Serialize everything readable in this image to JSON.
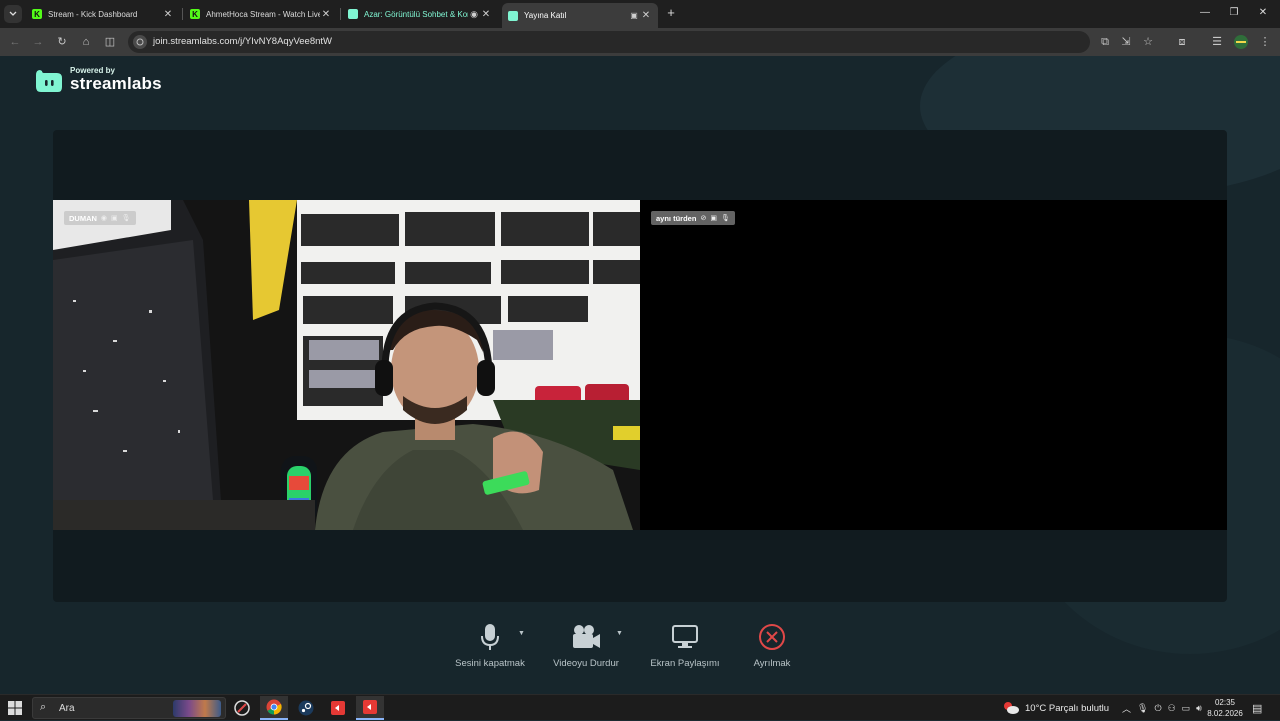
{
  "browser": {
    "tabs": [
      {
        "title": "Stream - Kick Dashboard",
        "favicon": "kick-icon",
        "active": false
      },
      {
        "title": "AhmetHoca Stream - Watch Live",
        "favicon": "kick-icon",
        "active": false
      },
      {
        "title": "Azar: Görüntülü Sohbet & Konuş",
        "favicon": "streamlabs-icon",
        "active": false
      },
      {
        "title": "Yayına Katıl",
        "favicon": "streamlabs-icon",
        "active": true
      }
    ],
    "url": "join.streamlabs.com/j/YIvNY8AqyVee8ntW"
  },
  "page": {
    "logo": {
      "powered_by": "Powered by",
      "name": "streamlabs"
    },
    "participants": [
      {
        "name": "DUMAN",
        "video": "camera-feed"
      },
      {
        "name": "aynı türden",
        "video": "none"
      }
    ],
    "controls": [
      {
        "label": "Sesini kapatmak",
        "icon": "microphone-icon",
        "has_dropdown": true
      },
      {
        "label": "Videoyu Durdur",
        "icon": "video-camera-icon",
        "has_dropdown": true
      },
      {
        "label": "Ekran Paylaşımı",
        "icon": "monitor-icon",
        "has_dropdown": false
      },
      {
        "label": "Ayrılmak",
        "icon": "leave-icon",
        "has_dropdown": false
      }
    ]
  },
  "taskbar": {
    "search_placeholder": "Ara",
    "weather": "10°C  Parçalı bulutlu",
    "time": "02:35",
    "date": "8.02.2026"
  },
  "colors": {
    "page_bg": "#17262c",
    "stage_bg": "#111b1f",
    "brand": "#80f5d2",
    "leave": "#e04848",
    "kick_green": "#53fc18"
  }
}
